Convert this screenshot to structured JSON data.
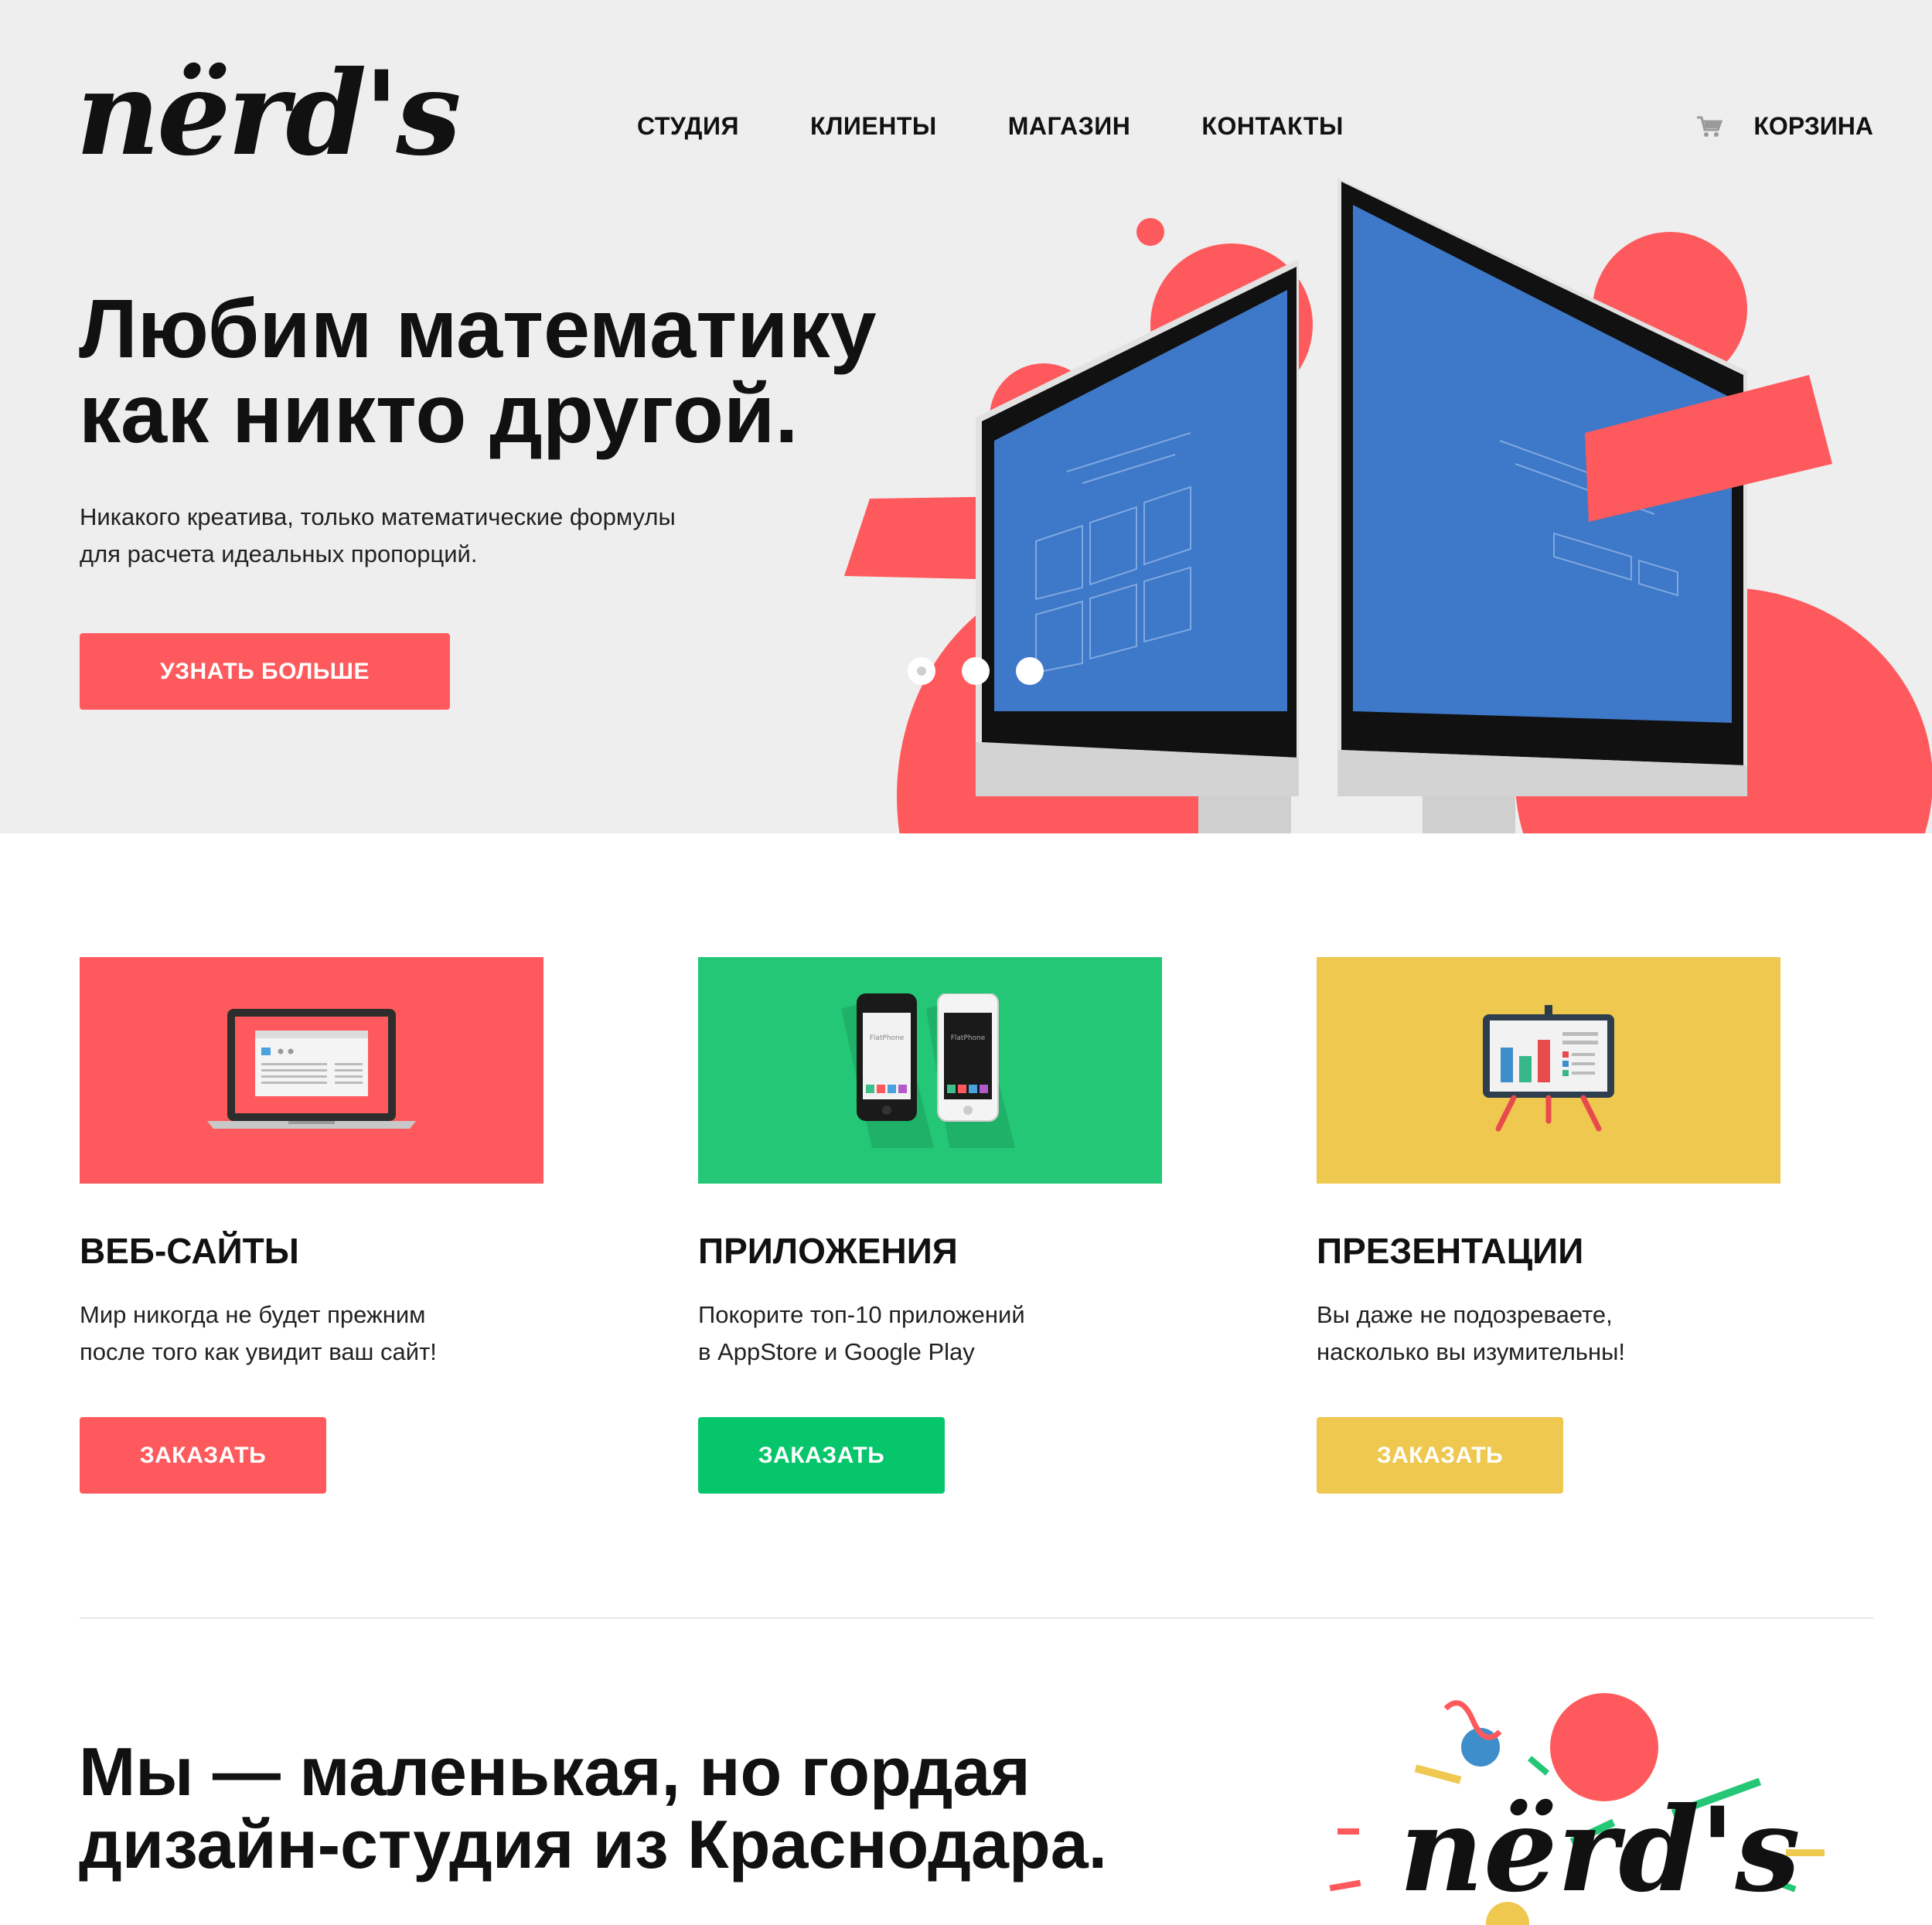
{
  "brand": {
    "logo_text": "nërd's"
  },
  "nav": {
    "items": [
      {
        "label": "СТУДИЯ"
      },
      {
        "label": "КЛИЕНТЫ"
      },
      {
        "label": "МАГАЗИН"
      },
      {
        "label": "КОНТАКТЫ"
      }
    ],
    "cart_label": "КОРЗИНА",
    "cart_icon": "cart-icon"
  },
  "hero": {
    "title_line1": "Любим математику",
    "title_line2": "как никто другой.",
    "text_line1": "Никакого креатива, только математические формулы",
    "text_line2": "для расчета идеальных пропорций.",
    "button_label": "УЗНАТЬ БОЛЬШЕ",
    "slider_count": 3,
    "slider_active": 1
  },
  "services": [
    {
      "title": "ВЕБ-САЙТЫ",
      "text_line1": "Мир никогда не будет прежним",
      "text_line2": "после того как увидит ваш сайт!",
      "button_label": "ЗАКАЗАТЬ",
      "color": "#fe5a5d",
      "button_color": "#fe5a5d",
      "icon": "laptop-icon"
    },
    {
      "title": "ПРИЛОЖЕНИЯ",
      "text_line1": "Покорите топ-10 приложений",
      "text_line2": "в AppStore и Google Play",
      "button_label": "ЗАКАЗАТЬ",
      "color": "#24c776",
      "button_color": "#06c66b",
      "icon": "smartphones-icon",
      "phone_label": "FlatPhone"
    },
    {
      "title": "ПРЕЗЕНТАЦИИ",
      "text_line1": "Вы даже не подозреваете,",
      "text_line2": "насколько вы изумительны!",
      "button_label": "ЗАКАЗАТЬ",
      "color": "#eec84f",
      "button_color": "#eec84f",
      "icon": "presentation-board-icon"
    }
  ],
  "about": {
    "title_line1": "Мы — маленькая, но гордая",
    "title_line2": "дизайн-студия из Краснодара.",
    "logo_text": "nërd's"
  },
  "colors": {
    "accent": "#fe5a5d",
    "hero_bg": "#eeeeee",
    "screen_blue": "#3e78c8"
  }
}
